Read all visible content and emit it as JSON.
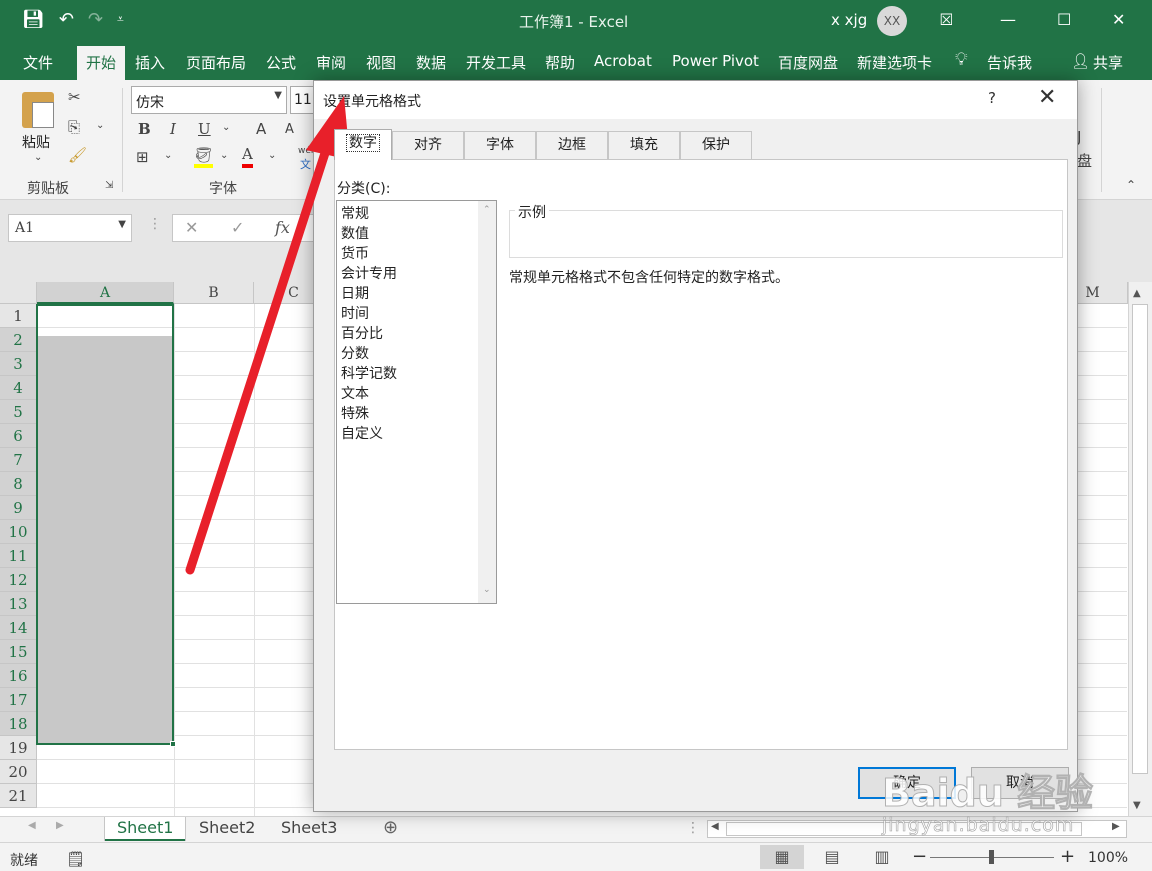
{
  "window": {
    "title": "工作簿1  -  Excel",
    "user": "x xjg",
    "avatar": "XX"
  },
  "menu": {
    "tabs": [
      "文件",
      "开始",
      "插入",
      "页面布局",
      "公式",
      "审阅",
      "视图",
      "数据",
      "开发工具",
      "帮助",
      "Acrobat",
      "Power Pivot",
      "百度网盘",
      "新建选项卡"
    ],
    "tell_me": "告诉我",
    "share": "共享"
  },
  "ribbon": {
    "paste_label": "粘贴",
    "clipboard_group": "剪贴板",
    "font_group": "字体",
    "font_name": "仿宋",
    "font_size": "11",
    "bold": "B",
    "italic": "I",
    "underline": "U",
    "grow_font": "A",
    "shrink_font": "A",
    "font_color": "A",
    "wen": "wén",
    "wen_char": "文",
    "right_btn_top": "J",
    "right_btn_bottom": "盘"
  },
  "formula_bar": {
    "name_box": "A1",
    "fx": "fx"
  },
  "grid": {
    "columns": [
      "A",
      "B",
      "C",
      "M"
    ],
    "rows": [
      "1",
      "2",
      "3",
      "4",
      "5",
      "6",
      "7",
      "8",
      "9",
      "10",
      "11",
      "12",
      "13",
      "14",
      "15",
      "16",
      "17",
      "18",
      "19",
      "20",
      "21"
    ]
  },
  "sheets": {
    "tabs": [
      "Sheet1",
      "Sheet2",
      "Sheet3"
    ],
    "active": "Sheet1"
  },
  "status": {
    "ready": "就绪",
    "zoom": "100%"
  },
  "dialog": {
    "title": "设置单元格格式",
    "help": "?",
    "tabs": [
      "数字",
      "对齐",
      "字体",
      "边框",
      "填充",
      "保护"
    ],
    "category_label": "分类(C):",
    "categories": [
      "常规",
      "数值",
      "货币",
      "会计专用",
      "日期",
      "时间",
      "百分比",
      "分数",
      "科学记数",
      "文本",
      "特殊",
      "自定义"
    ],
    "sample_label": "示例",
    "description": "常规单元格格式不包含任何特定的数字格式。",
    "ok": "确定",
    "cancel": "取消"
  },
  "watermark": {
    "brand": "Baidu 经验",
    "url": "jingyan.baidu.com"
  },
  "colors": {
    "excel_green": "#217346",
    "selection_gray": "#c8c8c8",
    "arrow_red": "#e8202a"
  }
}
